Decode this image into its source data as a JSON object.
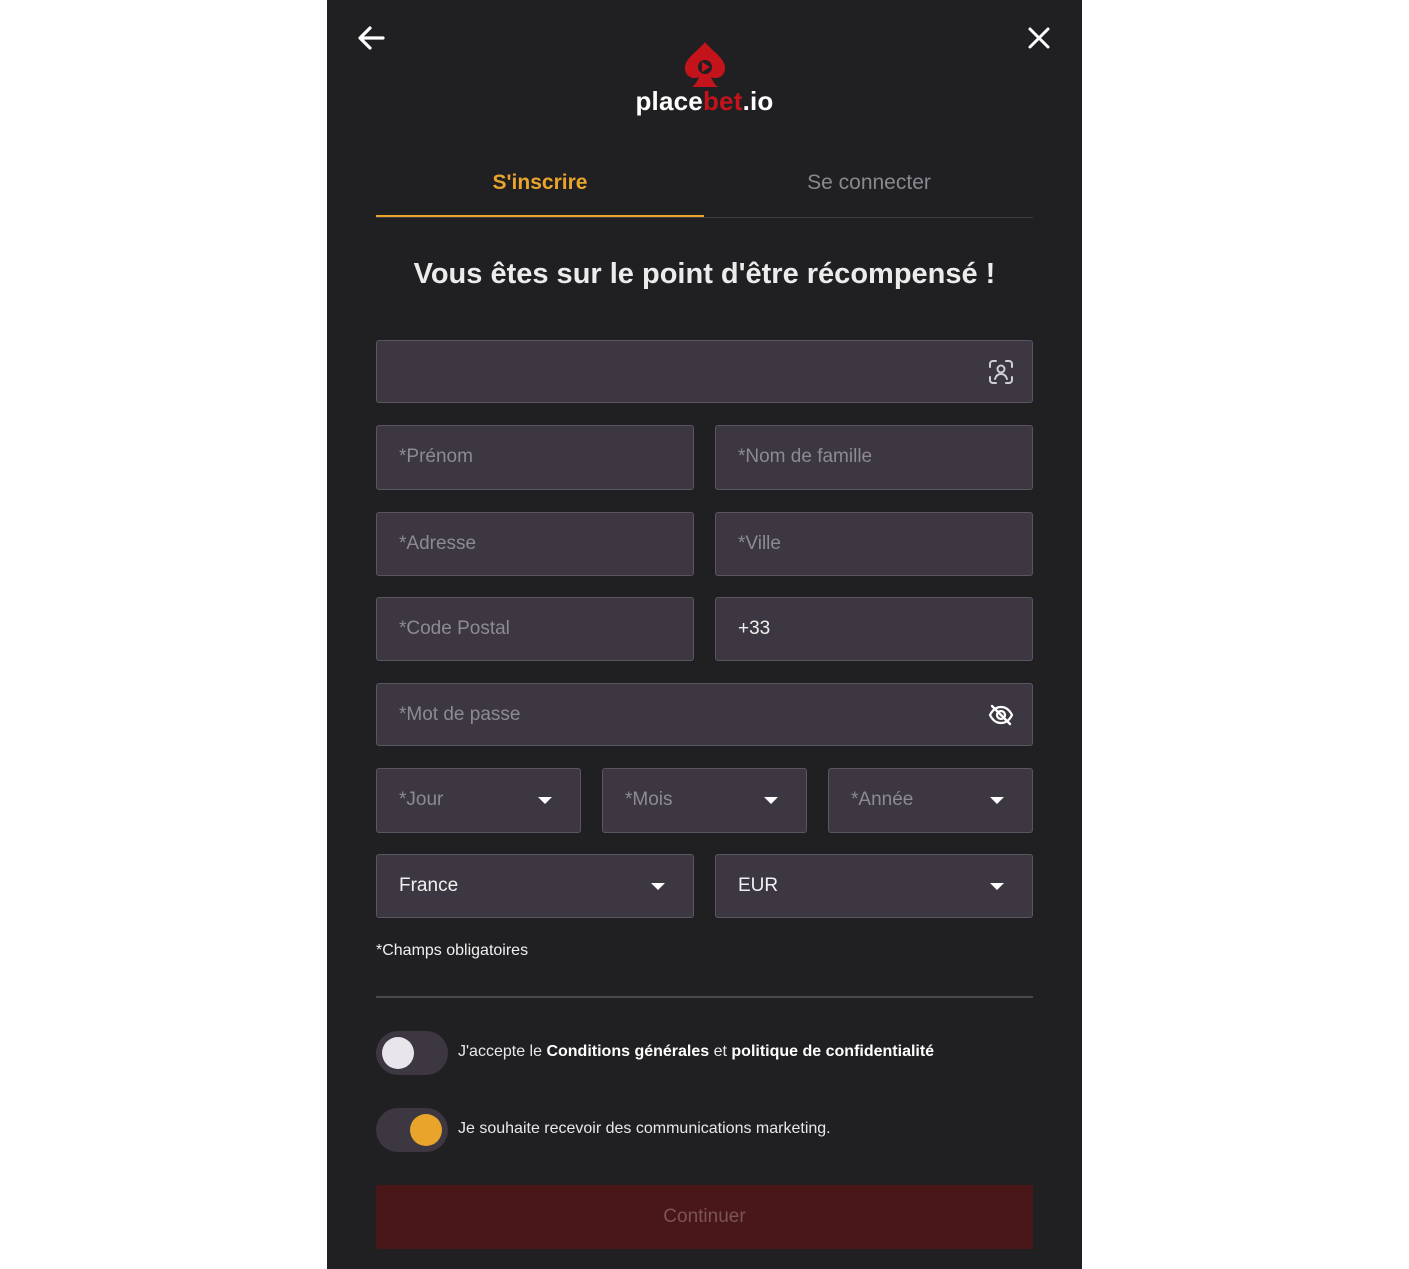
{
  "header": {
    "logo": {
      "word_main": "place",
      "word_accent": "bet",
      "word_suffix": ".io",
      "brand_color": "#c3141c"
    }
  },
  "tabs": {
    "register": "S'inscrire",
    "login": "Se connecter",
    "accent_color": "#e8a42b"
  },
  "headline": "Vous êtes sur le point d'être récompensé !",
  "form": {
    "first_name": {
      "placeholder": "*Prénom"
    },
    "last_name": {
      "placeholder": "*Nom de famille"
    },
    "address": {
      "placeholder": "*Adresse"
    },
    "city": {
      "placeholder": "*Ville"
    },
    "postal_code": {
      "placeholder": "*Code Postal"
    },
    "phone": {
      "value": "+33"
    },
    "password": {
      "placeholder": "*Mot de passe"
    },
    "day": {
      "placeholder": "*Jour"
    },
    "month": {
      "placeholder": "*Mois"
    },
    "year": {
      "placeholder": "*Année"
    },
    "country": {
      "value": "France"
    },
    "currency": {
      "value": "EUR"
    }
  },
  "required_note": "*Champs obligatoires",
  "terms": {
    "prefix": "J'accepte le",
    "conditions": "Conditions générales",
    "and": "et",
    "privacy": "politique de confidentialité",
    "checked": false
  },
  "marketing": {
    "label": "Je souhaite recevoir des communications marketing.",
    "checked": true
  },
  "continue_label": "Continuer"
}
